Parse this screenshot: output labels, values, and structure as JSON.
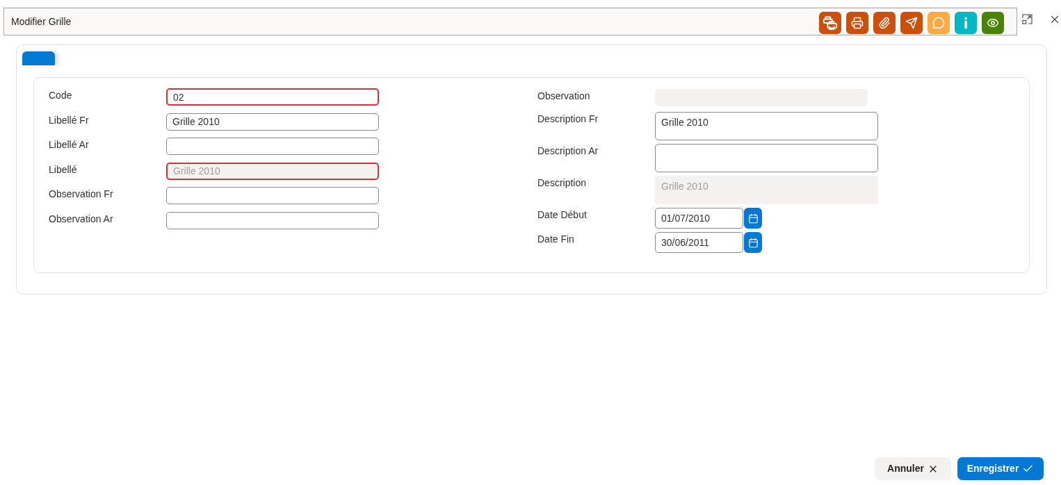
{
  "window": {
    "title": "Modifier Grille"
  },
  "toolbar": {
    "buttons": [
      {
        "kind": "print-multiple",
        "color": "#ca5010"
      },
      {
        "kind": "print",
        "color": "#ca5010"
      },
      {
        "kind": "attach",
        "color": "#ca5010"
      },
      {
        "kind": "send",
        "color": "#ca5010"
      },
      {
        "kind": "comment",
        "color": "#ffaa44"
      },
      {
        "kind": "info",
        "color": "#00b7c3"
      },
      {
        "kind": "view",
        "color": "#498205"
      }
    ]
  },
  "tabs": [
    {
      "selected": true
    }
  ],
  "form": {
    "left": [
      {
        "label": "Code",
        "kind": "input",
        "value": "02",
        "invalid": true,
        "disabled": false
      },
      {
        "label": "Libellé Fr",
        "kind": "input",
        "value": "Grille 2010",
        "invalid": false,
        "disabled": false
      },
      {
        "label": "Libellé Ar",
        "kind": "input",
        "invalid": false,
        "disabled": false
      },
      {
        "label": "Libellé",
        "kind": "input",
        "value": "Grille 2010",
        "invalid": true,
        "disabled": true
      },
      {
        "label": "Observation Fr",
        "kind": "input",
        "invalid": false,
        "disabled": false
      },
      {
        "label": "Observation Ar",
        "kind": "input",
        "invalid": false,
        "disabled": false
      }
    ],
    "right": [
      {
        "label": "Observation",
        "kind": "input",
        "invalid": false,
        "disabled": true
      },
      {
        "label": "Description Fr",
        "kind": "textarea",
        "value": "Grille 2010",
        "invalid": false,
        "disabled": false
      },
      {
        "label": "Description Ar",
        "kind": "textarea",
        "invalid": false,
        "disabled": false
      },
      {
        "label": "Description",
        "kind": "textarea",
        "value": "Grille 2010",
        "invalid": false,
        "disabled": true
      },
      {
        "label": "Date Début",
        "kind": "date",
        "value": "01/07/2010",
        "invalid": false,
        "disabled": false
      },
      {
        "label": "Date Fin",
        "kind": "date",
        "value": "30/06/2011",
        "invalid": false,
        "disabled": false
      }
    ]
  },
  "actions": [
    {
      "kind": "cancel",
      "label": "Annuler"
    },
    {
      "kind": "save",
      "label": "Enregistrer"
    }
  ]
}
